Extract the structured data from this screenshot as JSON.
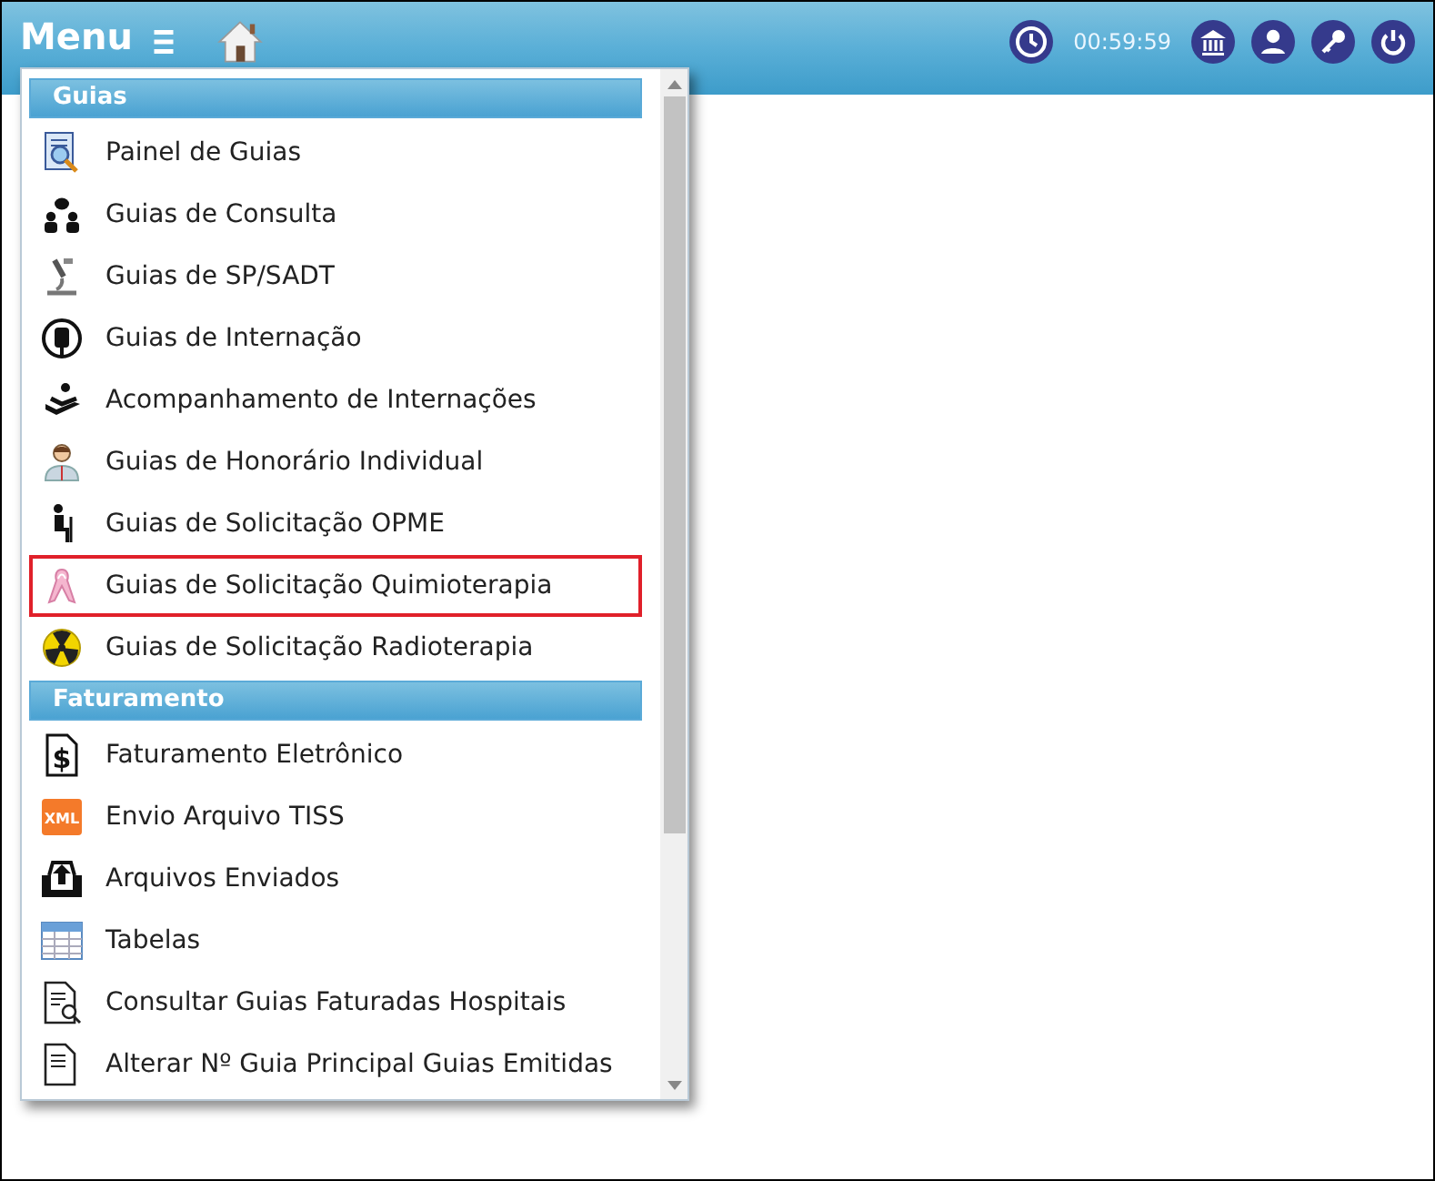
{
  "header": {
    "menu_label": "Menu",
    "session_time": "00:59:59"
  },
  "menu": {
    "sections": [
      {
        "title": "Guias",
        "items": [
          {
            "label": "Painel de Guias",
            "highlighted": false
          },
          {
            "label": "Guias de Consulta",
            "highlighted": false
          },
          {
            "label": "Guias de SP/SADT",
            "highlighted": false
          },
          {
            "label": "Guias de Internação",
            "highlighted": false
          },
          {
            "label": "Acompanhamento de Internações",
            "highlighted": false
          },
          {
            "label": "Guias de Honorário Individual",
            "highlighted": false
          },
          {
            "label": "Guias de Solicitação OPME",
            "highlighted": false
          },
          {
            "label": "Guias de Solicitação Quimioterapia",
            "highlighted": true
          },
          {
            "label": "Guias de Solicitação Radioterapia",
            "highlighted": false
          }
        ]
      },
      {
        "title": "Faturamento",
        "items": [
          {
            "label": "Faturamento Eletrônico",
            "highlighted": false,
            "icon_text": "$"
          },
          {
            "label": "Envio Arquivo TISS",
            "highlighted": false,
            "icon_text": "XML"
          },
          {
            "label": "Arquivos Enviados",
            "highlighted": false
          },
          {
            "label": "Tabelas",
            "highlighted": false
          },
          {
            "label": "Consultar Guias Faturadas Hospitais",
            "highlighted": false
          },
          {
            "label": "Alterar Nº Guia Principal Guias Emitidas",
            "highlighted": false
          }
        ]
      }
    ]
  }
}
